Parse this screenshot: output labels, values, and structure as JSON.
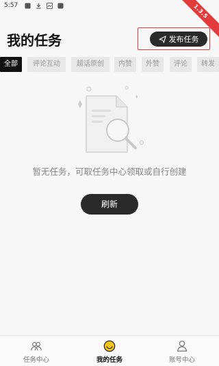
{
  "status_bar": {
    "time": "5:57",
    "version_badge": "1.3.5"
  },
  "header": {
    "title": "我的任务",
    "publish_label": "发布任务"
  },
  "tabs": [
    {
      "label": "全部",
      "active": true
    },
    {
      "label": "评论互动",
      "active": false
    },
    {
      "label": "超话原创",
      "active": false
    },
    {
      "label": "内赞",
      "active": false
    },
    {
      "label": "外赞",
      "active": false
    },
    {
      "label": "评论",
      "active": false
    },
    {
      "label": "转发",
      "active": false
    }
  ],
  "empty_state": {
    "message": "暂无任务，可取任务中心领取或自行创建",
    "refresh_label": "刷新"
  },
  "bottom_nav": [
    {
      "label": "任务中心",
      "icon": "tasks-icon",
      "active": false
    },
    {
      "label": "我的任务",
      "icon": "smiley-icon",
      "active": true
    },
    {
      "label": "账号中心",
      "icon": "user-icon",
      "active": false
    }
  ],
  "colors": {
    "accent_dark": "#2a2a2a",
    "highlight_border": "#e8373c",
    "nav_active_icon": "#f5c518"
  }
}
